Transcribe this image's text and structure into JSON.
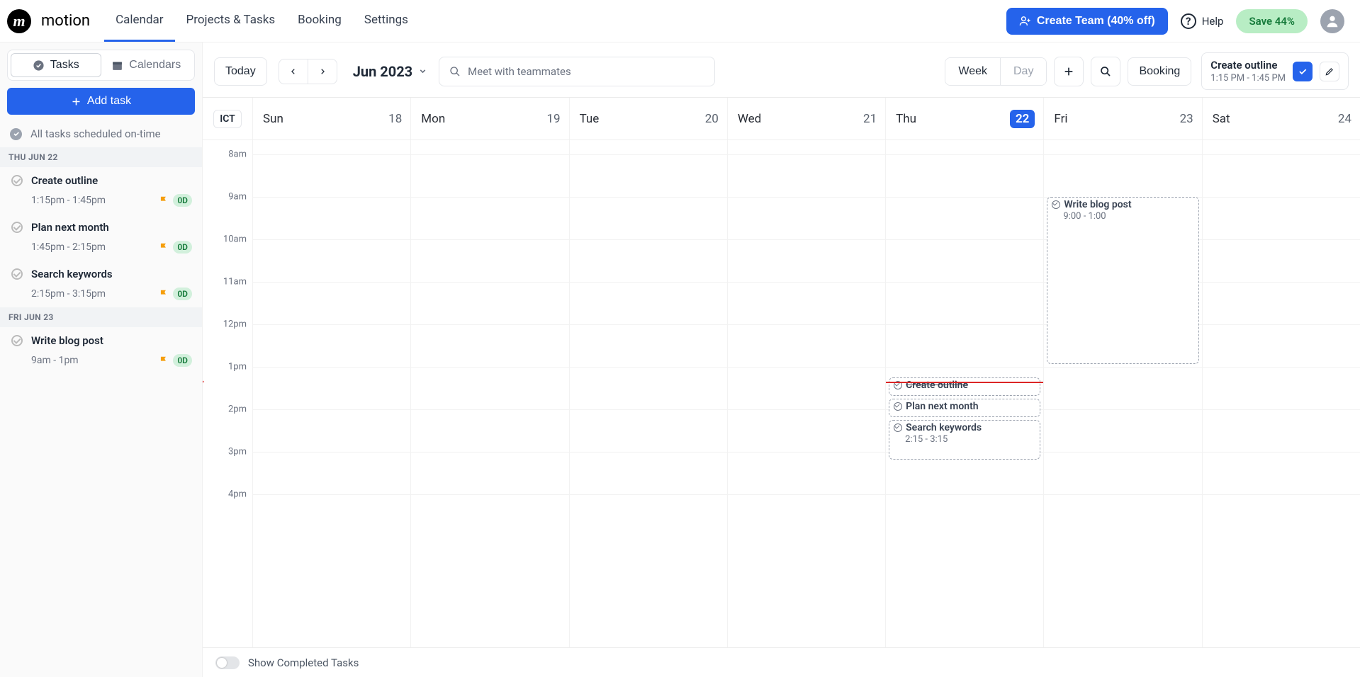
{
  "brand": "motion",
  "nav": [
    "Calendar",
    "Projects & Tasks",
    "Booking",
    "Settings"
  ],
  "activeNav": 0,
  "createTeam": "Create Team (40% off)",
  "help": "Help",
  "savePill": "Save 44%",
  "sidebar": {
    "segments": [
      "Tasks",
      "Calendars"
    ],
    "activeSegment": 0,
    "addTask": "Add task",
    "statusLine": "All tasks scheduled on-time",
    "days": [
      {
        "label": "THU JUN 22",
        "items": [
          {
            "title": "Create outline",
            "time": "1:15pm - 1:45pm",
            "badge": "0D"
          },
          {
            "title": "Plan next month",
            "time": "1:45pm - 2:15pm",
            "badge": "0D"
          },
          {
            "title": "Search keywords",
            "time": "2:15pm - 3:15pm",
            "badge": "0D"
          }
        ]
      },
      {
        "label": "FRI JUN 23",
        "items": [
          {
            "title": "Write blog post",
            "time": "9am - 1pm",
            "badge": "0D"
          }
        ]
      }
    ]
  },
  "toolbar": {
    "today": "Today",
    "month": "Jun 2023",
    "searchPlaceholder": "Meet with teammates",
    "view": [
      "Week",
      "Day"
    ],
    "activeView": 0,
    "booking": "Booking",
    "popover": {
      "title": "Create outline",
      "time": "1:15 PM - 1:45 PM"
    }
  },
  "calendar": {
    "tz": "ICT",
    "days": [
      {
        "dow": "Sun",
        "num": "18"
      },
      {
        "dow": "Mon",
        "num": "19"
      },
      {
        "dow": "Tue",
        "num": "20"
      },
      {
        "dow": "Wed",
        "num": "21"
      },
      {
        "dow": "Thu",
        "num": "22",
        "today": true
      },
      {
        "dow": "Fri",
        "num": "23"
      },
      {
        "dow": "Sat",
        "num": "24"
      }
    ],
    "hours": [
      "8am",
      "9am",
      "10am",
      "11am",
      "12pm",
      "1pm",
      "2pm",
      "3pm",
      "4pm"
    ],
    "hourHeight": 60,
    "nowOffsetMinutes": 21,
    "events": [
      {
        "day": 4,
        "startMin": 315,
        "durMin": 30,
        "title": "Create outline",
        "timeBelow": "",
        "strike": true
      },
      {
        "day": 4,
        "startMin": 345,
        "durMin": 30,
        "title": "Plan next month",
        "timeBelow": ""
      },
      {
        "day": 4,
        "startMin": 375,
        "durMin": 60,
        "title": "Search keywords",
        "timeBelow": "2:15 - 3:15"
      },
      {
        "day": 5,
        "startMin": 60,
        "durMin": 240,
        "title": "Write blog post",
        "timeBelow": "9:00 - 1:00"
      }
    ]
  },
  "footer": {
    "label": "Show Completed Tasks"
  }
}
